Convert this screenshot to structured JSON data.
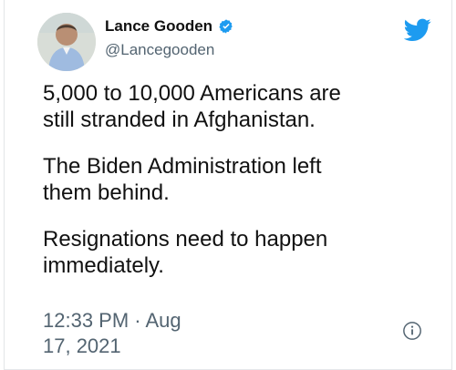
{
  "tweet": {
    "author": {
      "name": "Lance Gooden",
      "handle": "@Lancegooden",
      "verified": true
    },
    "text_lines": [
      "5,000 to 10,000 Americans are",
      "still stranded in Afghanistan.",
      "The Biden Administration left",
      "them behind.",
      "Resignations need to happen",
      "immediately."
    ],
    "time": "12:33 PM · Aug",
    "date": "17, 2021"
  },
  "icons": {
    "verified": "verified-badge-icon",
    "brand": "twitter-bird-icon",
    "info": "info-icon"
  },
  "colors": {
    "brand_blue": "#1d9bf0",
    "text": "#111111",
    "muted": "#536471"
  }
}
